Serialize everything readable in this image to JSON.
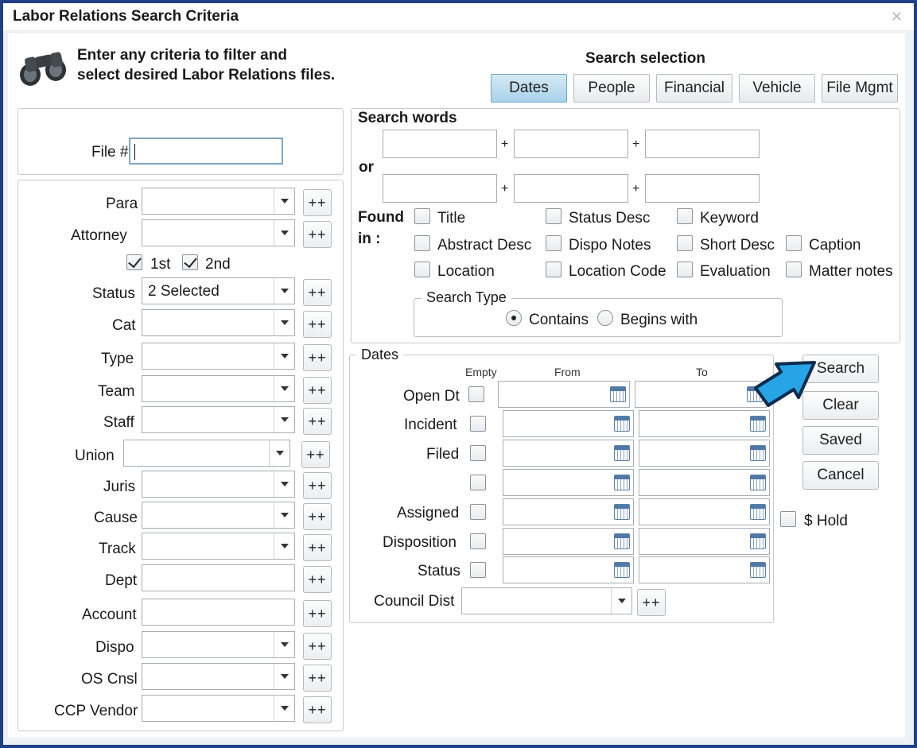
{
  "window": {
    "title": "Labor Relations Search Criteria",
    "close_glyph": "✕"
  },
  "intro": {
    "line1": "Enter any criteria to filter and",
    "line2": "select desired Labor Relations files."
  },
  "search_selection": {
    "label": "Search selection",
    "tabs": [
      "Dates",
      "People",
      "Financial",
      "Vehicle",
      "File Mgmt"
    ],
    "active": "Dates"
  },
  "file_no": {
    "label": "File #",
    "value": ""
  },
  "left_fields": {
    "para": "Para",
    "attorney": "Attorney",
    "first": "1st",
    "second": "2nd",
    "status": "Status",
    "status_value": "2 Selected",
    "cat": "Cat",
    "type": "Type",
    "team": "Team",
    "staff": "Staff",
    "union": "Union",
    "juris": "Juris",
    "cause": "Cause",
    "track": "Track",
    "dept": "Dept",
    "account": "Account",
    "dispo": "Dispo",
    "os_cnsl": "OS Cnsl",
    "ccp_vendor": "CCP Vendor",
    "plusplus": "++"
  },
  "search_words": {
    "label": "Search words",
    "or": "or",
    "plus": "+",
    "found_in_1": "Found",
    "found_in_2": "in :",
    "options": {
      "title": "Title",
      "status_desc": "Status Desc",
      "keyword": "Keyword",
      "abstract_desc": "Abstract Desc",
      "dispo_notes": "Dispo Notes",
      "short_desc": "Short Desc",
      "caption": "Caption",
      "location": "Location",
      "location_code": "Location Code",
      "evaluation": "Evaluation",
      "matter_notes": "Matter notes"
    },
    "search_type": {
      "label": "Search Type",
      "contains": "Contains",
      "begins_with": "Begins with",
      "selected": "Contains"
    }
  },
  "dates": {
    "label": "Dates",
    "col_empty": "Empty",
    "col_from": "From",
    "col_to": "To",
    "rows": {
      "open_dt": "Open Dt",
      "incident": "Incident",
      "filed": "Filed",
      "blank": "",
      "assigned": "Assigned",
      "disposition": "Disposition",
      "status": "Status"
    },
    "council_dist": "Council Dist"
  },
  "actions": {
    "search": "Search",
    "clear": "Clear",
    "saved": "Saved",
    "cancel": "Cancel",
    "hold": "$ Hold"
  },
  "colors": {
    "frame": "#1f3f86",
    "active_tab": "#a8d2ea",
    "pointer_arrow": "#27a4e6"
  },
  "icons": [
    "binoculars-icon",
    "calendar-icon",
    "chevron-down-icon",
    "close-icon",
    "pointer-arrow-icon"
  ]
}
